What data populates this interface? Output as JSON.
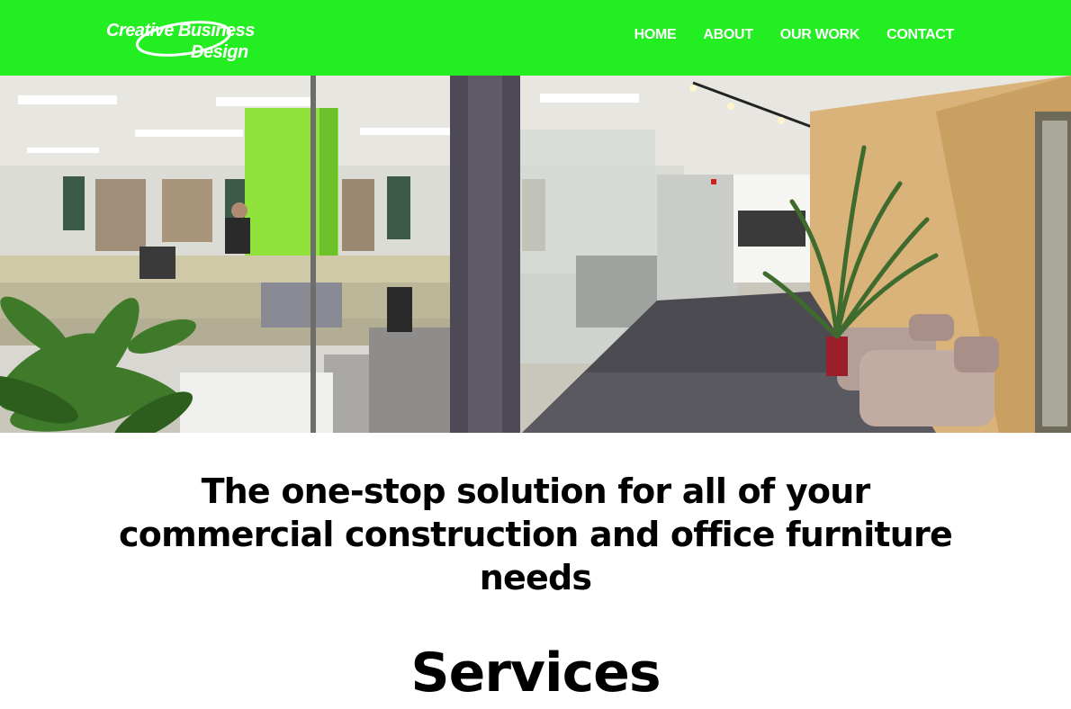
{
  "colors": {
    "brand_green": "#22ee22",
    "text": "#000000",
    "nav_text": "#ffffff"
  },
  "logo": {
    "line1": "Creative Business",
    "line2": "Design"
  },
  "nav": {
    "items": [
      {
        "label": "HOME"
      },
      {
        "label": "ABOUT"
      },
      {
        "label": "OUR WORK"
      },
      {
        "label": "CONTACT"
      }
    ]
  },
  "hero": {
    "image": "office-interior-photo"
  },
  "main": {
    "tagline": "The one-stop solution for all of your commercial construction and office furniture needs",
    "services_heading": "Services"
  }
}
